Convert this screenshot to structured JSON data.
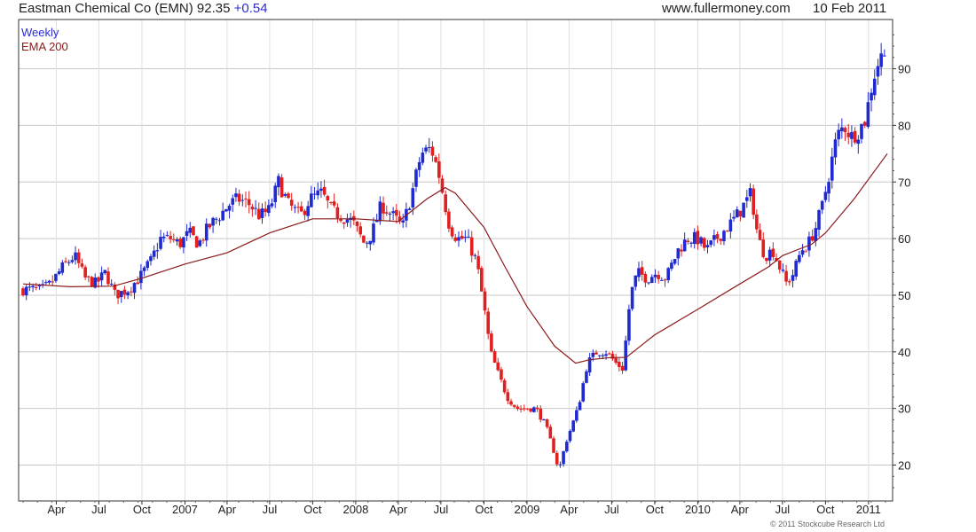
{
  "header": {
    "title": "Eastman Chemical Co (EMN) 92.35",
    "change": "+0.54",
    "site": "www.fullermoney.com",
    "date": "10 Feb 2011"
  },
  "footer": {
    "copyright": "© 2011 Stockcube Research Ltd"
  },
  "colors": {
    "up": "#1f2ad0",
    "down": "#e02020",
    "ema": "#8b1a1a",
    "legend_weekly": "#2b2bd8",
    "grid": "#c8c8c8"
  },
  "chart_data": {
    "type": "candlestick",
    "title": "Eastman Chemical Co (EMN) 92.35 +0.54",
    "frequency": "Weekly",
    "legend": [
      {
        "name": "Weekly",
        "color": "#2b2bd8"
      },
      {
        "name": "EMA 200",
        "color": "#8b1a1a"
      }
    ],
    "legend_position": "top-left",
    "x_tick_labels": [
      "Apr",
      "Jul",
      "Oct",
      "2007",
      "Apr",
      "Jul",
      "Oct",
      "2008",
      "Apr",
      "Jul",
      "Oct",
      "2009",
      "Apr",
      "Jul",
      "Oct",
      "2010",
      "Apr",
      "Jul",
      "Oct",
      "2011"
    ],
    "x_tick_dates": [
      "2006-04-01",
      "2006-07-01",
      "2006-10-01",
      "2007-01-01",
      "2007-04-01",
      "2007-07-01",
      "2007-10-01",
      "2008-01-01",
      "2008-04-01",
      "2008-07-01",
      "2008-10-01",
      "2009-01-01",
      "2009-04-01",
      "2009-07-01",
      "2009-10-01",
      "2010-01-01",
      "2010-04-01",
      "2010-07-01",
      "2010-10-01",
      "2011-01-01"
    ],
    "y_ticks": [
      20,
      30,
      40,
      50,
      60,
      70,
      80,
      90
    ],
    "y_range": [
      15,
      97
    ],
    "grid": true,
    "price_series": [
      [
        "2006-01-20",
        51
      ],
      [
        "2006-03-01",
        51
      ],
      [
        "2006-03-20",
        52
      ],
      [
        "2006-04-15",
        55
      ],
      [
        "2006-05-10",
        57
      ],
      [
        "2006-06-01",
        53
      ],
      [
        "2006-06-25",
        52
      ],
      [
        "2006-07-15",
        54
      ],
      [
        "2006-08-05",
        50
      ],
      [
        "2006-09-01",
        51
      ],
      [
        "2006-09-25",
        53
      ],
      [
        "2006-10-20",
        56
      ],
      [
        "2006-11-10",
        60
      ],
      [
        "2006-12-01",
        60
      ],
      [
        "2006-12-20",
        59
      ],
      [
        "2007-01-10",
        61
      ],
      [
        "2007-01-30",
        59
      ],
      [
        "2007-02-20",
        62
      ],
      [
        "2007-03-15",
        64
      ],
      [
        "2007-04-05",
        66
      ],
      [
        "2007-04-25",
        67
      ],
      [
        "2007-05-20",
        66
      ],
      [
        "2007-06-10",
        64
      ],
      [
        "2007-06-30",
        65
      ],
      [
        "2007-07-20",
        70
      ],
      [
        "2007-08-10",
        66
      ],
      [
        "2007-09-05",
        64
      ],
      [
        "2007-09-25",
        67
      ],
      [
        "2007-10-20",
        68
      ],
      [
        "2007-11-10",
        65
      ],
      [
        "2007-12-01",
        64
      ],
      [
        "2007-12-25",
        63
      ],
      [
        "2008-01-20",
        59
      ],
      [
        "2008-02-05",
        61
      ],
      [
        "2008-02-25",
        66
      ],
      [
        "2008-03-20",
        64
      ],
      [
        "2008-04-10",
        62
      ],
      [
        "2008-04-30",
        68
      ],
      [
        "2008-05-20",
        75
      ],
      [
        "2008-06-10",
        76
      ],
      [
        "2008-06-25",
        72
      ],
      [
        "2008-07-10",
        66
      ],
      [
        "2008-07-20",
        62
      ],
      [
        "2008-08-05",
        60
      ],
      [
        "2008-08-25",
        60
      ],
      [
        "2008-09-15",
        56
      ],
      [
        "2008-10-01",
        48
      ],
      [
        "2008-10-15",
        40
      ],
      [
        "2008-11-01",
        36
      ],
      [
        "2008-11-20",
        32
      ],
      [
        "2008-12-10",
        30
      ],
      [
        "2008-12-30",
        30
      ],
      [
        "2009-01-20",
        30
      ],
      [
        "2009-02-10",
        27
      ],
      [
        "2009-03-01",
        22
      ],
      [
        "2009-03-10",
        19
      ],
      [
        "2009-03-25",
        24
      ],
      [
        "2009-04-20",
        30
      ],
      [
        "2009-05-10",
        38
      ],
      [
        "2009-05-30",
        40
      ],
      [
        "2009-06-20",
        40
      ],
      [
        "2009-07-10",
        38
      ],
      [
        "2009-07-25",
        37
      ],
      [
        "2009-08-10",
        50
      ],
      [
        "2009-08-25",
        54
      ],
      [
        "2009-09-15",
        53
      ],
      [
        "2009-10-05",
        54
      ],
      [
        "2009-10-25",
        53
      ],
      [
        "2009-11-20",
        58
      ],
      [
        "2009-12-10",
        60
      ],
      [
        "2009-12-31",
        60
      ],
      [
        "2010-01-20",
        58
      ],
      [
        "2010-02-10",
        60
      ],
      [
        "2010-03-05",
        62
      ],
      [
        "2010-03-25",
        64
      ],
      [
        "2010-04-10",
        66
      ],
      [
        "2010-04-25",
        68
      ],
      [
        "2010-05-10",
        60
      ],
      [
        "2010-05-25",
        57
      ],
      [
        "2010-06-10",
        58
      ],
      [
        "2010-06-25",
        55
      ],
      [
        "2010-07-10",
        52
      ],
      [
        "2010-07-25",
        54
      ],
      [
        "2010-08-10",
        58
      ],
      [
        "2010-08-25",
        59
      ],
      [
        "2010-09-10",
        62
      ],
      [
        "2010-09-25",
        66
      ],
      [
        "2010-10-10",
        72
      ],
      [
        "2010-10-25",
        78
      ],
      [
        "2010-11-10",
        80
      ],
      [
        "2010-11-25",
        78
      ],
      [
        "2010-12-10",
        79
      ],
      [
        "2010-12-25",
        81
      ],
      [
        "2011-01-10",
        88
      ],
      [
        "2011-01-25",
        92
      ],
      [
        "2011-02-10",
        92.35
      ]
    ],
    "ema200_series": [
      [
        "2006-01-20",
        52
      ],
      [
        "2006-05-01",
        51.5
      ],
      [
        "2006-08-01",
        51.6
      ],
      [
        "2006-10-01",
        53
      ],
      [
        "2007-01-01",
        55.5
      ],
      [
        "2007-04-01",
        57.5
      ],
      [
        "2007-07-01",
        61
      ],
      [
        "2007-10-01",
        63.5
      ],
      [
        "2008-01-01",
        63.5
      ],
      [
        "2008-04-01",
        63
      ],
      [
        "2008-06-01",
        67
      ],
      [
        "2008-07-10",
        69
      ],
      [
        "2008-08-01",
        68
      ],
      [
        "2008-10-01",
        62
      ],
      [
        "2008-11-15",
        55
      ],
      [
        "2009-01-01",
        48
      ],
      [
        "2009-03-01",
        41
      ],
      [
        "2009-04-15",
        38
      ],
      [
        "2009-05-15",
        38.6
      ],
      [
        "2009-07-01",
        39
      ],
      [
        "2009-08-01",
        39
      ],
      [
        "2009-10-01",
        43
      ],
      [
        "2010-01-01",
        47.5
      ],
      [
        "2010-04-01",
        52
      ],
      [
        "2010-06-01",
        55
      ],
      [
        "2010-07-01",
        57
      ],
      [
        "2010-09-01",
        59
      ],
      [
        "2010-10-01",
        61
      ],
      [
        "2010-12-01",
        67
      ],
      [
        "2011-02-10",
        75
      ]
    ]
  }
}
